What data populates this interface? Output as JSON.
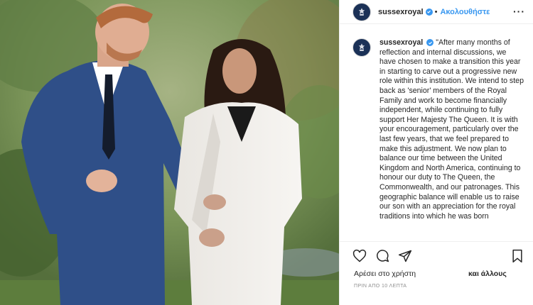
{
  "post": {
    "username": "sussexroyal",
    "dot": "•",
    "follow_label": "Ακολουθήστε",
    "more_label": "···",
    "caption": "\"After many months of reflection and internal discussions, we have chosen to make a transition this year in starting to carve out a progressive new role within this institution. We intend to step back as 'senior' members of the Royal Family and work to become financially independent, while continuing to fully support Her Majesty The Queen. It is with your encouragement, particularly over the last few years, that we feel prepared to make this adjustment. We now plan to balance our time between the United Kingdom and North America, continuing to honour our duty to The Queen, the Commonwealth, and our patronages. This geographic balance will enable us to raise our son with an appreciation for the royal traditions into which he was born",
    "liked_by_label": "Αρέσει στο χρήστη",
    "and_others_label": "και άλλους",
    "timestamp": "ΠΡΙΝ ΑΠΟ 10 ΛΕΠΤΑ"
  },
  "icons": {
    "avatar": "crest-icon",
    "verified": "verified-badge-icon",
    "like": "heart-icon",
    "comment": "comment-icon",
    "share": "share-icon",
    "save": "bookmark-icon"
  },
  "colors": {
    "accent": "#3897f0",
    "avatar_bg": "#1b3157",
    "text": "#262626",
    "muted": "#8e8e8e"
  }
}
